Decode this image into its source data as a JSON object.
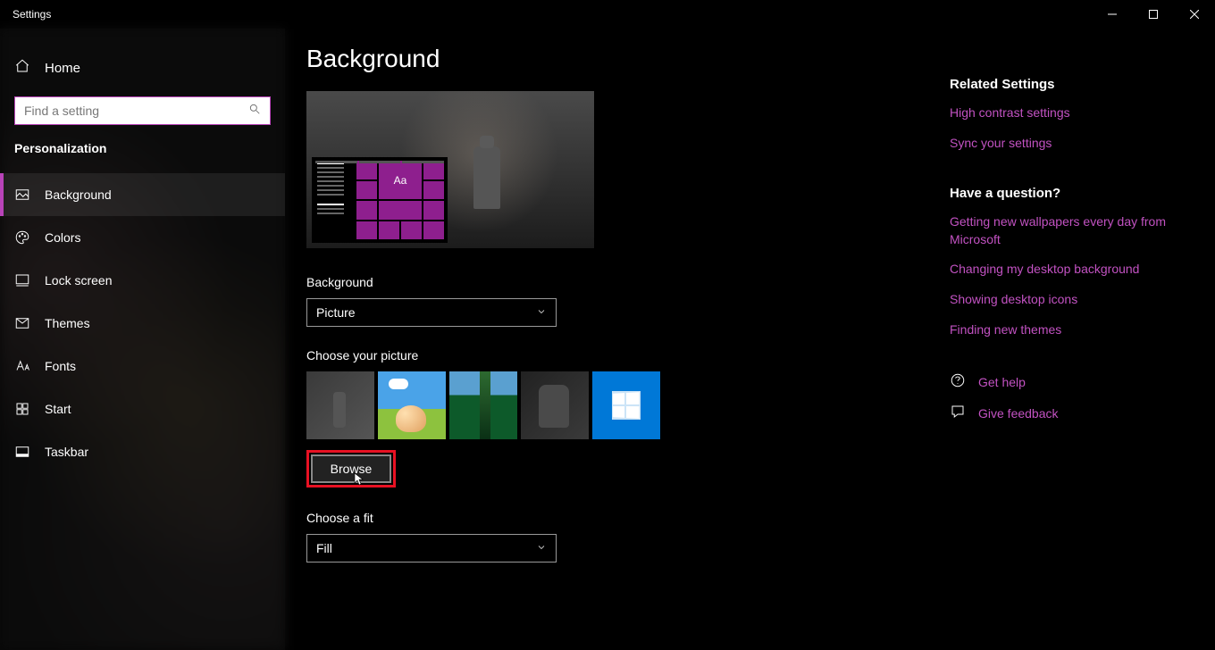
{
  "window": {
    "title": "Settings"
  },
  "sidebar": {
    "home": "Home",
    "search_placeholder": "Find a setting",
    "section": "Personalization",
    "items": [
      {
        "label": "Background"
      },
      {
        "label": "Colors"
      },
      {
        "label": "Lock screen"
      },
      {
        "label": "Themes"
      },
      {
        "label": "Fonts"
      },
      {
        "label": "Start"
      },
      {
        "label": "Taskbar"
      }
    ]
  },
  "page": {
    "title": "Background",
    "preview_sample": "Aa",
    "bg_label": "Background",
    "bg_value": "Picture",
    "choose_label": "Choose your picture",
    "browse": "Browse",
    "fit_label": "Choose a fit",
    "fit_value": "Fill"
  },
  "right": {
    "related_title": "Related Settings",
    "links_related": [
      "High contrast settings",
      "Sync your settings"
    ],
    "question_title": "Have a question?",
    "links_question": [
      "Getting new wallpapers every day from Microsoft",
      "Changing my desktop background",
      "Showing desktop icons",
      "Finding new themes"
    ],
    "get_help": "Get help",
    "give_feedback": "Give feedback"
  }
}
